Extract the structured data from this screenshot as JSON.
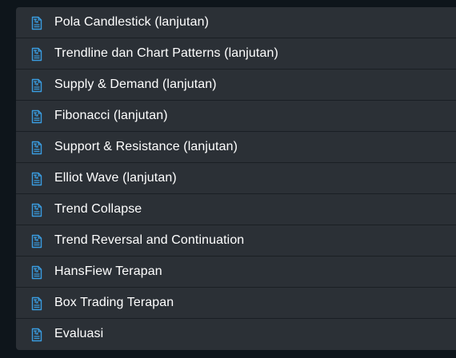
{
  "accent_color": "#3a9ce0",
  "lessons": [
    {
      "icon": "text-document-icon",
      "label": "Pola Candlestick (lanjutan)"
    },
    {
      "icon": "text-document-icon",
      "label": "Trendline dan Chart Patterns (lanjutan)"
    },
    {
      "icon": "text-document-icon",
      "label": "Supply & Demand (lanjutan)"
    },
    {
      "icon": "text-document-icon",
      "label": "Fibonacci (lanjutan)"
    },
    {
      "icon": "text-document-icon",
      "label": "Support & Resistance (lanjutan)"
    },
    {
      "icon": "text-document-icon",
      "label": "Elliot Wave (lanjutan)"
    },
    {
      "icon": "text-document-icon",
      "label": "Trend Collapse"
    },
    {
      "icon": "text-document-icon",
      "label": "Trend Reversal and Continuation"
    },
    {
      "icon": "text-document-icon",
      "label": "HansFiew Terapan"
    },
    {
      "icon": "text-document-icon",
      "label": "Box Trading Terapan"
    },
    {
      "icon": "text-document-icon",
      "label": "Evaluasi"
    }
  ]
}
